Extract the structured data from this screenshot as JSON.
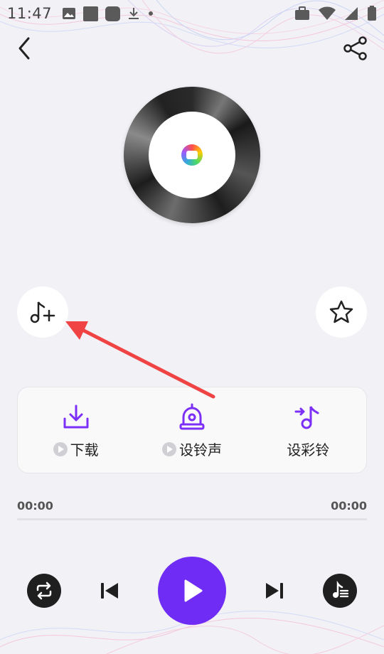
{
  "status_bar": {
    "time": "11:47",
    "icons": [
      "image-icon",
      "square-icon",
      "rounded-square-icon",
      "download-icon",
      "dot-icon",
      "briefcase-icon",
      "wifi-icon",
      "signal-icon",
      "battery-icon"
    ]
  },
  "nav": {
    "back_icon": "chevron-left-icon",
    "share_icon": "share-icon"
  },
  "player": {
    "disc_icon": "vinyl-record-icon",
    "add_to_playlist_icon": "music-note-plus-icon",
    "favorite_icon": "star-icon"
  },
  "actions": [
    {
      "label": "下载",
      "icon": "download-tray-icon",
      "badge": true
    },
    {
      "label": "设铃声",
      "icon": "alarm-bell-icon",
      "badge": true
    },
    {
      "label": "设彩铃",
      "icon": "music-note-arrow-icon",
      "badge": false
    }
  ],
  "progress": {
    "current_time": "00:00",
    "total_time": "00:00",
    "fraction": 0
  },
  "controls": {
    "loop_icon": "repeat-icon",
    "prev_icon": "skip-previous-icon",
    "play_icon": "play-icon",
    "next_icon": "skip-next-icon",
    "playlist_icon": "playlist-icon"
  },
  "colors": {
    "accent": "#6f2cf5",
    "icon_purple": "#7b2ff7",
    "annotation_red": "#f04444",
    "background": "#f2f1f5"
  }
}
